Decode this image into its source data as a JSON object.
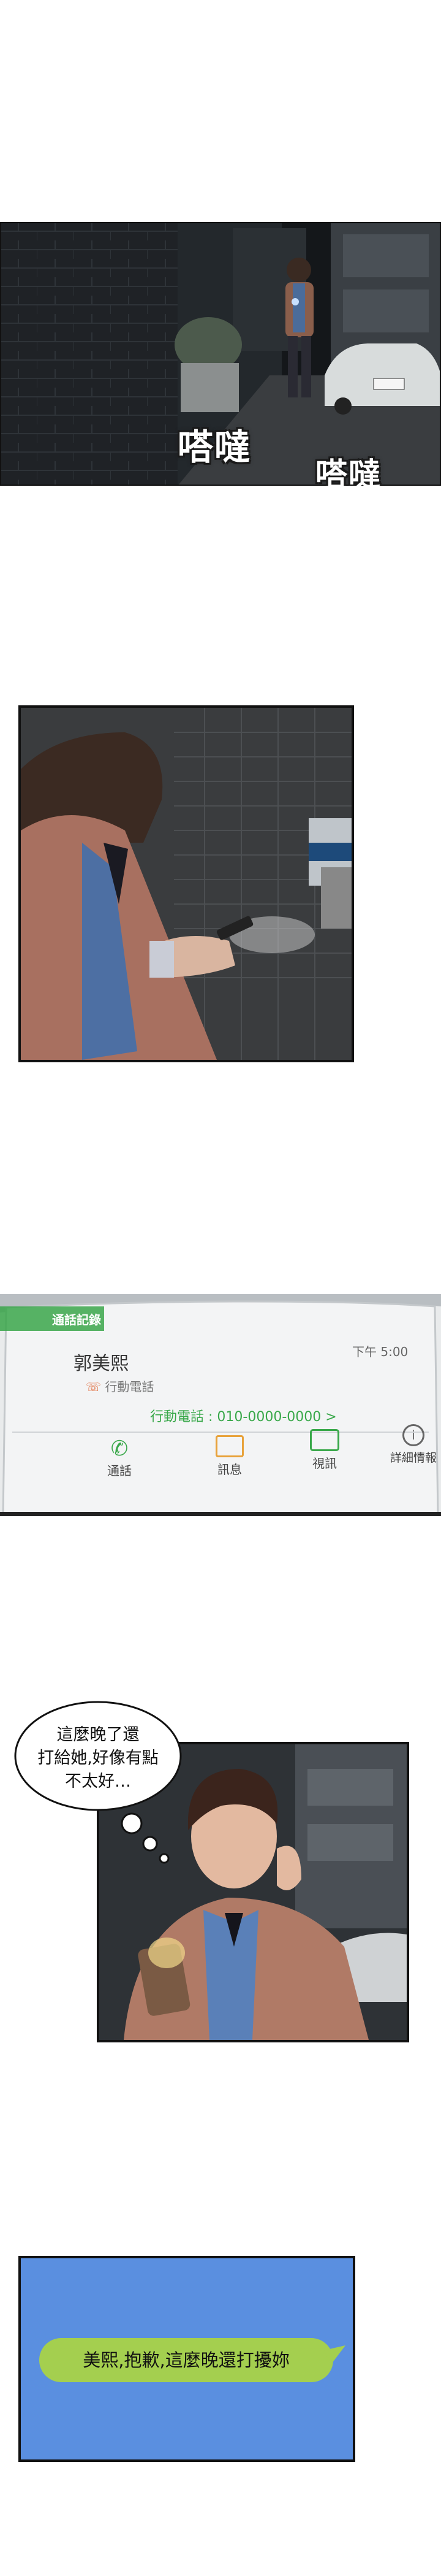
{
  "panel1": {
    "sfx_left": "嗒噠",
    "sfx_right": "嗒噠"
  },
  "panel3": {
    "header": "通話記錄",
    "time": "下午 5:00",
    "contact_name": "郭美熙",
    "contact_type": "行動電話",
    "phone_line": "行動電話 : 010-0000-0000 >",
    "actions": [
      {
        "icon": "phone-icon",
        "label": "通話"
      },
      {
        "icon": "message-icon",
        "label": "訊息"
      },
      {
        "icon": "video-icon",
        "label": "視訊"
      },
      {
        "icon": "info-icon",
        "label": "詳細情報"
      }
    ]
  },
  "panel4": {
    "thought": [
      "這麼晚了還",
      "打給她,好像有點",
      "不太好…"
    ]
  },
  "panel5": {
    "message": "美熙,抱歉,這麼晚還打擾妳"
  }
}
